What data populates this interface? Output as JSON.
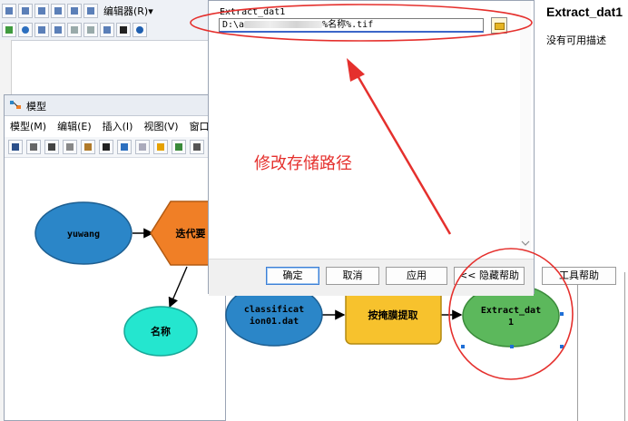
{
  "toolbar": {
    "editor_label": "编辑器(R)▾"
  },
  "model_window": {
    "title": "模型",
    "menus": [
      "模型(M)",
      "编辑(E)",
      "插入(I)",
      "视图(V)",
      "窗口(W)"
    ]
  },
  "diagram": {
    "nodes": {
      "yuwang": "yuwang",
      "iterator": "迭代要",
      "name": "名称",
      "classification_line1": "classificat",
      "classification_line2": "ion01.dat",
      "extract_tool": "按掩膜提取",
      "extract_out_line1": "Extract_dat",
      "extract_out_line2": "1"
    }
  },
  "dialog": {
    "param_label": "Extract_dat1",
    "path_prefix": "D:\\a",
    "path_suffix": "%名称%.tif",
    "buttons": {
      "ok": "确定",
      "cancel": "取消",
      "apply": "应用",
      "hide_help": "<< 隐藏帮助",
      "tool_help": "工具帮助"
    }
  },
  "help_panel": {
    "title": "Extract_dat1",
    "description": "没有可用描述"
  },
  "annotation": {
    "text": "修改存储路径",
    "color": "#e5302d"
  },
  "colors": {
    "input_blue": "#2b86c8",
    "tool_orange": "#f07f26",
    "tool_yellow": "#f7c22d",
    "output_green": "#5cb85c",
    "derived_cyan": "#24e6cf"
  }
}
